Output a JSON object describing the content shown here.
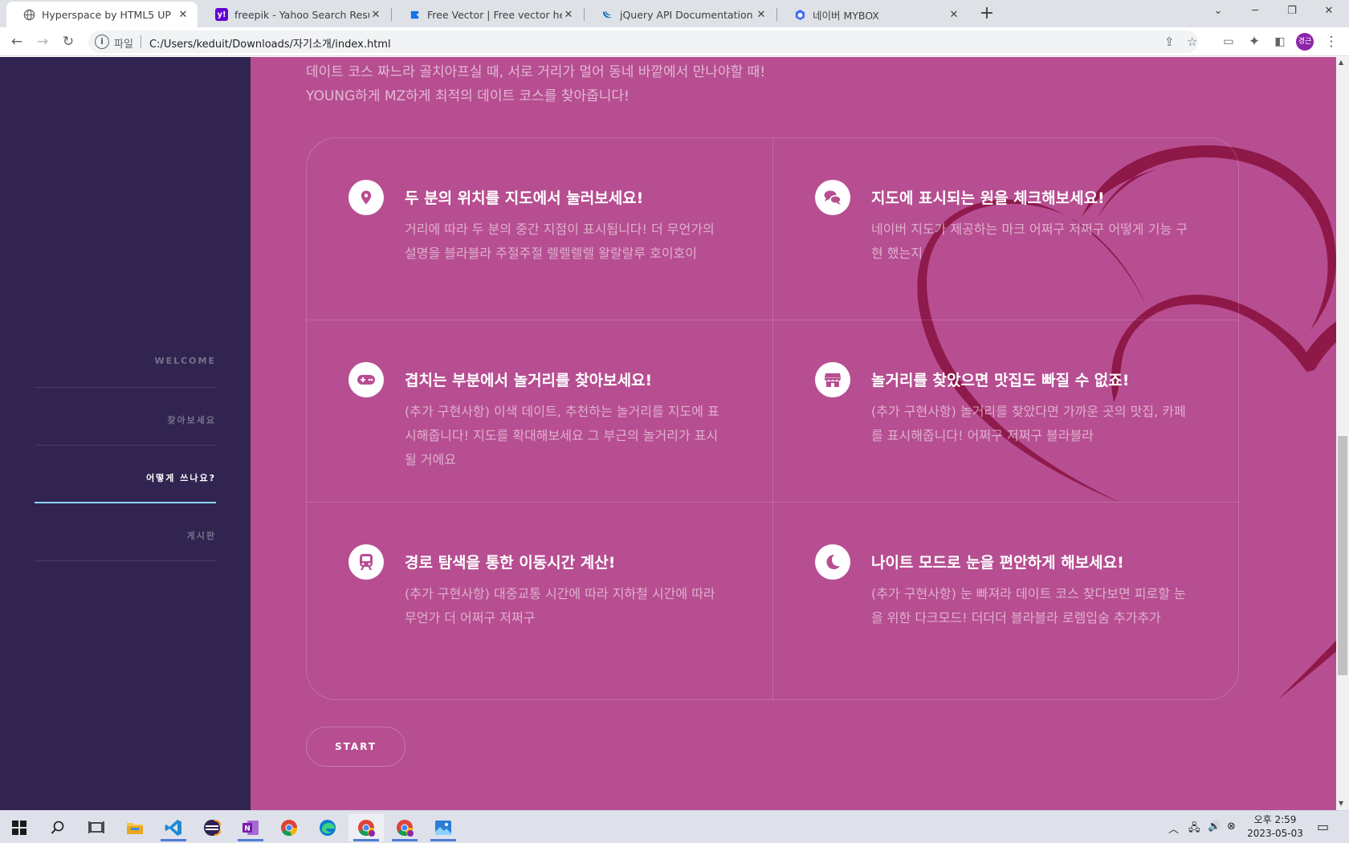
{
  "browser": {
    "tabs": [
      {
        "title": "Hyperspace by HTML5 UP",
        "icon": "globe-icon",
        "active": true
      },
      {
        "title": "freepik - Yahoo Search Results",
        "icon": "yahoo-icon",
        "active": false
      },
      {
        "title": "Free Vector | Free vector hearts",
        "icon": "freepik-icon",
        "active": false
      },
      {
        "title": "jQuery API Documentation",
        "icon": "jquery-icon",
        "active": false
      },
      {
        "title": "네이버 MYBOX",
        "icon": "mybox-icon",
        "active": false
      }
    ],
    "address": {
      "scheme_label": "파일",
      "url": "C:/Users/keduit/Downloads/자기소개/index.html"
    },
    "profile_initials": "경근"
  },
  "sidebar": {
    "items": [
      {
        "label": "WELCOME"
      },
      {
        "label": "찾아보세요"
      },
      {
        "label": "어떻게 쓰나요?"
      },
      {
        "label": "게시판"
      }
    ],
    "active_index": 2,
    "active_color": "#8ad6ff"
  },
  "main": {
    "intro": [
      "데이트 코스 짜느라 골치아프실 때, 서로 거리가 멀어 동네 바깥에서 만나야할 때!",
      "YOUNG하게 MZ하게 최적의 데이트 코스를 찾아줍니다!"
    ],
    "features": [
      {
        "icon": "map-pin-icon",
        "title": "두 분의 위치를 지도에서 눌러보세요!",
        "desc": "거리에 따라 두 분의 중간 지점이 표시됩니다! 더 무언가의 설명을 블라블라 주절주절 렐렐렐렐 왈랄랄루 호이호이"
      },
      {
        "icon": "chat-bubbles-icon",
        "title": "지도에 표시되는 원을 체크해보세요!",
        "desc": "네이버 지도가 제공하는 마크 어쩌구 저쩌구 어떻게 기능 구현 했는지"
      },
      {
        "icon": "gamepad-icon",
        "title": "겹치는 부분에서 놀거리를 찾아보세요!",
        "desc": "(추가 구현사항) 이색 데이트, 추천하는 놀거리를 지도에 표시해줍니다! 지도를 확대해보세요 그 부근의 놀거리가 표시될 거에요"
      },
      {
        "icon": "store-icon",
        "title": "놀거리를 찾았으면 맛집도 빠질 수 없죠!",
        "desc": "(추가 구현사항) 놀거리를 찾았다면 가까운 곳의 맛집, 카페를 표시해줍니다! 어쩌구 저쩌구 블라블라"
      },
      {
        "icon": "train-icon",
        "title": "경로 탐색을 통한 이동시간 계산!",
        "desc": "(추가 구현사항) 대중교통 시간에 따라 지하철 시간에 따라 무언가 더 어쩌구 저쩌구"
      },
      {
        "icon": "moon-icon",
        "title": "나이트 모드로 눈을 편안하게 해보세요!",
        "desc": "(추가 구현사항) 눈 빠져라 데이트 코스 찾다보면 피로할 눈을 위한 다크모드! 더더더 블라블라 로렘입숨 추가추가"
      }
    ],
    "start_label": "START",
    "colors": {
      "sidebar": "#312450",
      "main": "#b74e91",
      "heart": "#8b1545"
    }
  },
  "taskbar": {
    "apps": [
      "start-icon",
      "search-icon",
      "task-view-icon",
      "file-explorer-icon",
      "vscode-icon",
      "eclipse-icon",
      "onenote-icon",
      "chrome-icon",
      "edge-icon",
      "chrome-profile-icon",
      "chrome-profile-icon",
      "photos-icon"
    ],
    "clock": {
      "period_time": "오후 2:59",
      "date": "2023-05-03"
    }
  }
}
